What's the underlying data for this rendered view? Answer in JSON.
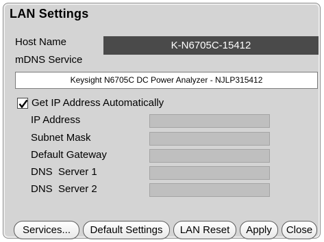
{
  "dialog": {
    "title": "LAN Settings",
    "host_name": {
      "label": "Host Name",
      "value": "K-N6705C-15412"
    },
    "mdns": {
      "label": "mDNS Service",
      "value": "Keysight N6705C DC Power Analyzer - NJLP315412"
    },
    "auto_ip": {
      "label": "Get IP Address Automatically",
      "checked": true
    },
    "fields": [
      {
        "label": "IP Address",
        "value": ""
      },
      {
        "label": "Subnet Mask",
        "value": ""
      },
      {
        "label": "Default Gateway",
        "value": ""
      },
      {
        "label": "DNS  Server 1",
        "value": ""
      },
      {
        "label": "DNS  Server 2",
        "value": ""
      }
    ],
    "buttons": {
      "services": "Services...",
      "default_settings": "Default Settings",
      "lan_reset": "LAN Reset",
      "apply": "Apply",
      "close": "Close"
    }
  },
  "colors": {
    "dialog_bg": "#d4d4d4",
    "host_value_bg": "#4a4a4a",
    "disabled_field_bg": "#bfbfbf"
  },
  "icons": {
    "checkbox_mark": "check-mark-icon"
  }
}
